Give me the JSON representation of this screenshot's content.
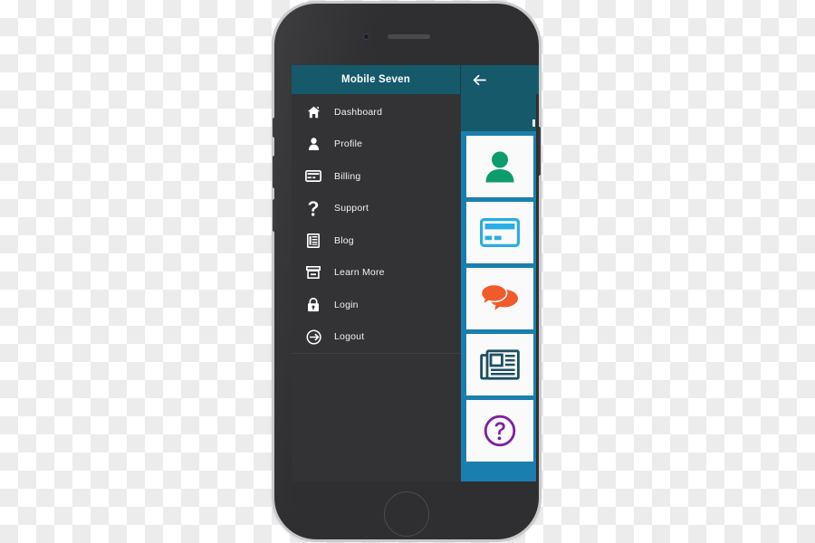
{
  "app": {
    "title": "Mobile Seven",
    "back_icon": "arrow-left-icon",
    "header_color": "#15596b",
    "drawer_bg": "#333335",
    "tile_strip_color": "#1a7fad"
  },
  "drawer": {
    "items": [
      {
        "label": "Dashboard",
        "icon": "home-icon"
      },
      {
        "label": "Profile",
        "icon": "user-icon"
      },
      {
        "label": "Billing",
        "icon": "credit-card-icon"
      },
      {
        "label": "Support",
        "icon": "question-mark-icon"
      },
      {
        "label": "Blog",
        "icon": "document-lines-icon"
      },
      {
        "label": "Learn More",
        "icon": "archive-box-icon"
      },
      {
        "label": "Login",
        "icon": "lock-icon"
      },
      {
        "label": "Logout",
        "icon": "sign-out-icon"
      }
    ]
  },
  "tiles": [
    {
      "name": "profile-tile",
      "icon": "user-icon",
      "color": "#0d9c6e"
    },
    {
      "name": "billing-tile",
      "icon": "credit-card-icon",
      "color": "#29ade4"
    },
    {
      "name": "support-chat-tile",
      "icon": "chat-bubbles-icon",
      "color": "#f15a29"
    },
    {
      "name": "blog-tile",
      "icon": "newspaper-icon",
      "color": "#1c4f63"
    },
    {
      "name": "help-tile",
      "icon": "question-circle-icon",
      "color": "#7b1fa2"
    }
  ],
  "device": {
    "camera": "front-camera",
    "speaker": "earpiece-speaker",
    "home_button": "home-button"
  }
}
